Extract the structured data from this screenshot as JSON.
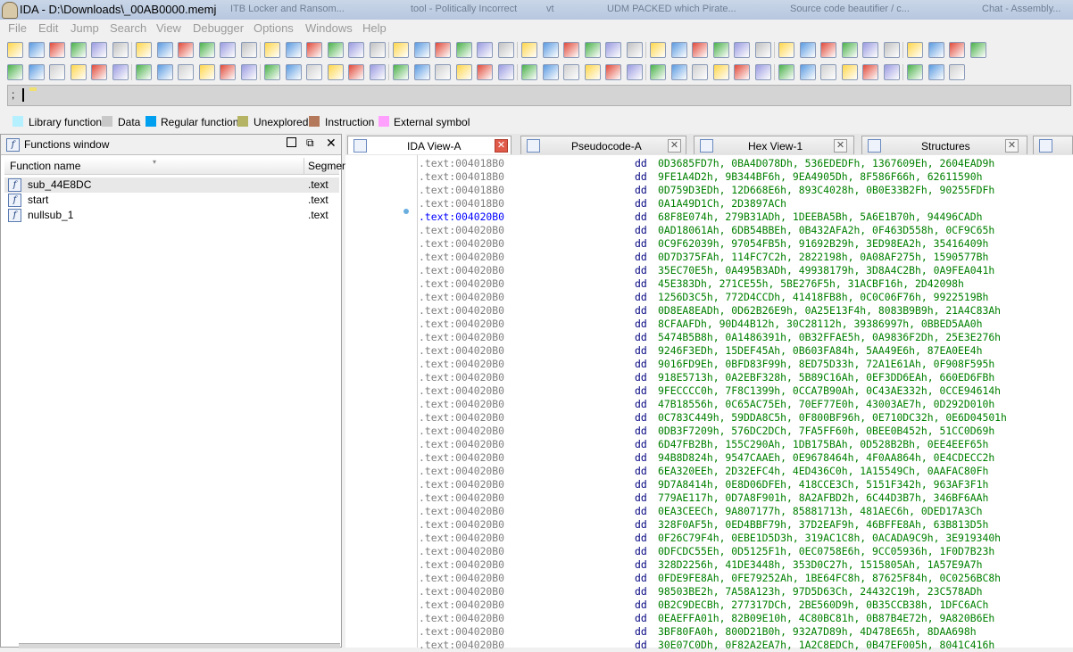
{
  "window": {
    "title": "IDA - D:\\Downloads\\_00AB0000.memj",
    "ghost_tabs": [
      "ITB Locker and Ransom...",
      "tool - Politically Incorrect",
      "vt",
      "UDM PACKED which Pirate...",
      "Source code beautifier / c...",
      "Chat - Assembly..."
    ]
  },
  "menu": [
    "File",
    "Edit",
    "Jump",
    "Search",
    "View",
    "Debugger",
    "Options",
    "Windows",
    "Help"
  ],
  "toolbar1_icons": [
    "open-icon",
    "save-icon",
    "back-icon",
    "back-dropdown-icon",
    "forward-icon",
    "forward-dropdown-icon",
    "binoculars-icon",
    "binoculars-text-icon",
    "binoculars-hex-icon",
    "binoculars-next-icon",
    "arrow-down-icon",
    "mark-icon",
    "warning-icon",
    "run-green-icon",
    "minus-icon",
    "plus-icon",
    "cross-icon",
    "window1-icon",
    "window2-icon",
    "bug-icon",
    "list1-icon",
    "list2-icon",
    "tree-icon",
    "search-icon",
    "graph-icon",
    "print-icon",
    "gear-icon",
    "color-icon",
    "export1-icon",
    "export2-icon",
    "export3-icon",
    "function-icon",
    "struct-icon",
    "edit-icon",
    "save2-icon",
    "text-a-icon",
    "text-b-icon",
    "panel1-icon",
    "panel2-icon",
    "panel3-icon",
    "panel4-icon",
    "panel5-icon",
    "panel6-icon",
    "play-icon",
    "pause-icon",
    "stop-icon"
  ],
  "toolbar2_icons": [
    "add-segment-icon",
    "add-a-icon",
    "add-b-icon",
    "add-c-icon",
    "add-d-icon",
    "edit-func-icon",
    "delete-icon",
    "gray1-icon",
    "gray2-icon",
    "gray3-icon",
    "code-icon",
    "code-dropdown-icon",
    "data-icon",
    "data-dropdown-icon",
    "tools1-icon",
    "tools2-icon",
    "tools3-icon",
    "tools4-icon",
    "tools5-icon",
    "tools6-icon",
    "grid-icon",
    "table-icon",
    "export-icon",
    "import-icon",
    "f-icon",
    "f-list-icon",
    "f-green-icon",
    "gray4-icon",
    "gray5-icon",
    "gray6-icon",
    "gray7-icon",
    "gray8-icon",
    "gray9-icon",
    "gray10-icon",
    "gray11-icon",
    "gray12-icon",
    "gray13-icon",
    "note-icon",
    "note2-icon",
    "align1-icon",
    "align2-icon",
    "hier1-icon",
    "hier2-icon",
    "hier3-icon",
    "hier4-icon"
  ],
  "cmdbar": {
    "prompt": ";"
  },
  "legend": [
    {
      "label": "Library function",
      "color": "#b4f0ff"
    },
    {
      "label": "Data",
      "color": "#c8c8c8"
    },
    {
      "label": "Regular function",
      "color": "#00a0f0"
    },
    {
      "label": "Unexplored",
      "color": "#b4b464"
    },
    {
      "label": "Instruction",
      "color": "#b4785a"
    },
    {
      "label": "External symbol",
      "color": "#ffa0ff"
    }
  ],
  "functions_window": {
    "title": "Functions window",
    "columns": [
      "Function name",
      "Segmen"
    ],
    "rows": [
      {
        "name": "sub_44E8DC",
        "segment": ".text"
      },
      {
        "name": "start",
        "segment": ".text"
      },
      {
        "name": "nullsub_1",
        "segment": ".text"
      }
    ]
  },
  "tabs": [
    {
      "label": "IDA View-A",
      "active": true
    },
    {
      "label": "Pseudocode-A",
      "active": false
    },
    {
      "label": "Hex View-1",
      "active": false
    },
    {
      "label": "Structures",
      "active": false
    }
  ],
  "ida_view": {
    "lines": [
      {
        "addr": ".text:004018B0",
        "kw": "dd",
        "vals": "0D3685FD7h, 0BA4D078Dh, 536EDEDFh, 1367609Eh, 2604EAD9h"
      },
      {
        "addr": ".text:004018B0",
        "kw": "dd",
        "vals": "9FE1A4D2h, 9B344BF6h, 9EA4905Dh, 8F586F66h, 62611590h"
      },
      {
        "addr": ".text:004018B0",
        "kw": "dd",
        "vals": "0D759D3EDh, 12D668E6h, 893C4028h, 0B0E33B2Fh, 90255FDFh"
      },
      {
        "addr": ".text:004018B0",
        "kw": "dd",
        "vals": "0A1A49D1Ch, 2D3897ACh"
      },
      {
        "addr": ".text:004020B0",
        "kw": "dd",
        "vals": "68F8E074h, 279B31ADh, 1DEEBA5Bh, 5A6E1B70h, 94496CADh",
        "hl": true
      },
      {
        "addr": ".text:004020B0",
        "kw": "dd",
        "vals": "0AD18061Ah, 6DB54BBEh, 0B432AFA2h, 0F463D558h, 0CF9C65h"
      },
      {
        "addr": ".text:004020B0",
        "kw": "dd",
        "vals": "0C9F62039h, 97054FB5h, 91692B29h, 3ED98EA2h, 35416409h"
      },
      {
        "addr": ".text:004020B0",
        "kw": "dd",
        "vals": "0D7D375FAh, 114FC7C2h, 2822198h, 0A08AF275h, 1590577Bh"
      },
      {
        "addr": ".text:004020B0",
        "kw": "dd",
        "vals": "35EC70E5h, 0A495B3ADh, 49938179h, 3D8A4C2Bh, 0A9FEA041h"
      },
      {
        "addr": ".text:004020B0",
        "kw": "dd",
        "vals": "45E383Dh, 271CE55h, 5BE276F5h, 31ACBF16h, 2D42098h"
      },
      {
        "addr": ".text:004020B0",
        "kw": "dd",
        "vals": "1256D3C5h, 772D4CCDh, 41418FB8h, 0C0C06F76h, 9922519Bh"
      },
      {
        "addr": ".text:004020B0",
        "kw": "dd",
        "vals": "0D8EA8EADh, 0D62B26E9h, 0A25E13F4h, 8083B9B9h, 21A4C83Ah"
      },
      {
        "addr": ".text:004020B0",
        "kw": "dd",
        "vals": "8CFAAFDh, 90D44B12h, 30C28112h, 39386997h, 0BBED5AA0h"
      },
      {
        "addr": ".text:004020B0",
        "kw": "dd",
        "vals": "5474B5B8h, 0A1486391h, 0B32FFAE5h, 0A9836F2Dh, 25E3E276h"
      },
      {
        "addr": ".text:004020B0",
        "kw": "dd",
        "vals": "9246F3EDh, 15DEF45Ah, 0B603FA84h, 5AA49E6h, 87EA0EE4h"
      },
      {
        "addr": ".text:004020B0",
        "kw": "dd",
        "vals": "9016FD9Eh, 0BFD83F99h, 8ED75D33h, 72A1E61Ah, 0F908F595h"
      },
      {
        "addr": ".text:004020B0",
        "kw": "dd",
        "vals": "918E5713h, 0A2EBF328h, 5B89C16Ah, 0EF3DD6EAh, 660ED6FBh"
      },
      {
        "addr": ".text:004020B0",
        "kw": "dd",
        "vals": "9FECCCC0h, 7F8C1399h, 0CCA7B90Ah, 0C43AE332h, 0CCE94614h"
      },
      {
        "addr": ".text:004020B0",
        "kw": "dd",
        "vals": "47B18556h, 0C65AC75Eh, 70EF77E0h, 43003AE7h, 0D292D010h"
      },
      {
        "addr": ".text:004020B0",
        "kw": "dd",
        "vals": "0C783C449h, 59DDA8C5h, 0F800BF96h, 0E710DC32h, 0E6D04501h"
      },
      {
        "addr": ".text:004020B0",
        "kw": "dd",
        "vals": "0DB3F7209h, 576DC2DCh, 7FA5FF60h, 0BEE0B452h, 51CC0D69h"
      },
      {
        "addr": ".text:004020B0",
        "kw": "dd",
        "vals": "6D47FB2Bh, 155C290Ah, 1DB175BAh, 0D528B2Bh, 0EE4EEF65h"
      },
      {
        "addr": ".text:004020B0",
        "kw": "dd",
        "vals": "94B8D824h, 9547CAAEh, 0E9678464h, 4F0AA864h, 0E4CDECC2h"
      },
      {
        "addr": ".text:004020B0",
        "kw": "dd",
        "vals": "6EA320EEh, 2D32EFC4h, 4ED436C0h, 1A15549Ch, 0AAFAC80Fh"
      },
      {
        "addr": ".text:004020B0",
        "kw": "dd",
        "vals": "9D7A8414h, 0E8D06DFEh, 418CCE3Ch, 5151F342h, 963AF3F1h"
      },
      {
        "addr": ".text:004020B0",
        "kw": "dd",
        "vals": "779AE117h, 0D7A8F901h, 8A2AFBD2h, 6C44D3B7h, 346BF6AAh"
      },
      {
        "addr": ".text:004020B0",
        "kw": "dd",
        "vals": "0EA3CEECh, 9A807177h, 85881713h, 481AEC6h, 0DED17A3Ch"
      },
      {
        "addr": ".text:004020B0",
        "kw": "dd",
        "vals": "328F0AF5h, 0ED4BBF79h, 37D2EAF9h, 46BFFE8Ah, 63B813D5h"
      },
      {
        "addr": ".text:004020B0",
        "kw": "dd",
        "vals": "0F26C79F4h, 0EBE1D5D3h, 319AC1C8h, 0ACADA9C9h, 3E919340h"
      },
      {
        "addr": ".text:004020B0",
        "kw": "dd",
        "vals": "0DFCDC55Eh, 0D5125F1h, 0EC0758E6h, 9CC05936h, 1F0D7B23h"
      },
      {
        "addr": ".text:004020B0",
        "kw": "dd",
        "vals": "328D2256h, 41DE3448h, 353D0C27h, 1515805Ah, 1A57E9A7h"
      },
      {
        "addr": ".text:004020B0",
        "kw": "dd",
        "vals": "0FDE9FE8Ah, 0FE79252Ah, 1BE64FC8h, 87625F84h, 0C0256BC8h"
      },
      {
        "addr": ".text:004020B0",
        "kw": "dd",
        "vals": "98503BE2h, 7A58A123h, 97D5D63Ch, 24432C19h, 23C578ADh"
      },
      {
        "addr": ".text:004020B0",
        "kw": "dd",
        "vals": "0B2C9DECBh, 277317DCh, 2BE560D9h, 0B35CCB38h, 1DFC6ACh"
      },
      {
        "addr": ".text:004020B0",
        "kw": "dd",
        "vals": "0EAEFFA01h, 82B09E10h, 4C80BC81h, 0B87B4E72h, 9A820B6Eh"
      },
      {
        "addr": ".text:004020B0",
        "kw": "dd",
        "vals": "3BF80FA0h, 800D21B0h, 932A7D89h, 4D478E65h, 8DAA698h"
      },
      {
        "addr": ".text:004020B0",
        "kw": "dd",
        "vals": "30E07C0Dh, 0F82A2EA7h, 1A2C8EDCh, 0B47EF005h, 8041C416h"
      }
    ]
  }
}
